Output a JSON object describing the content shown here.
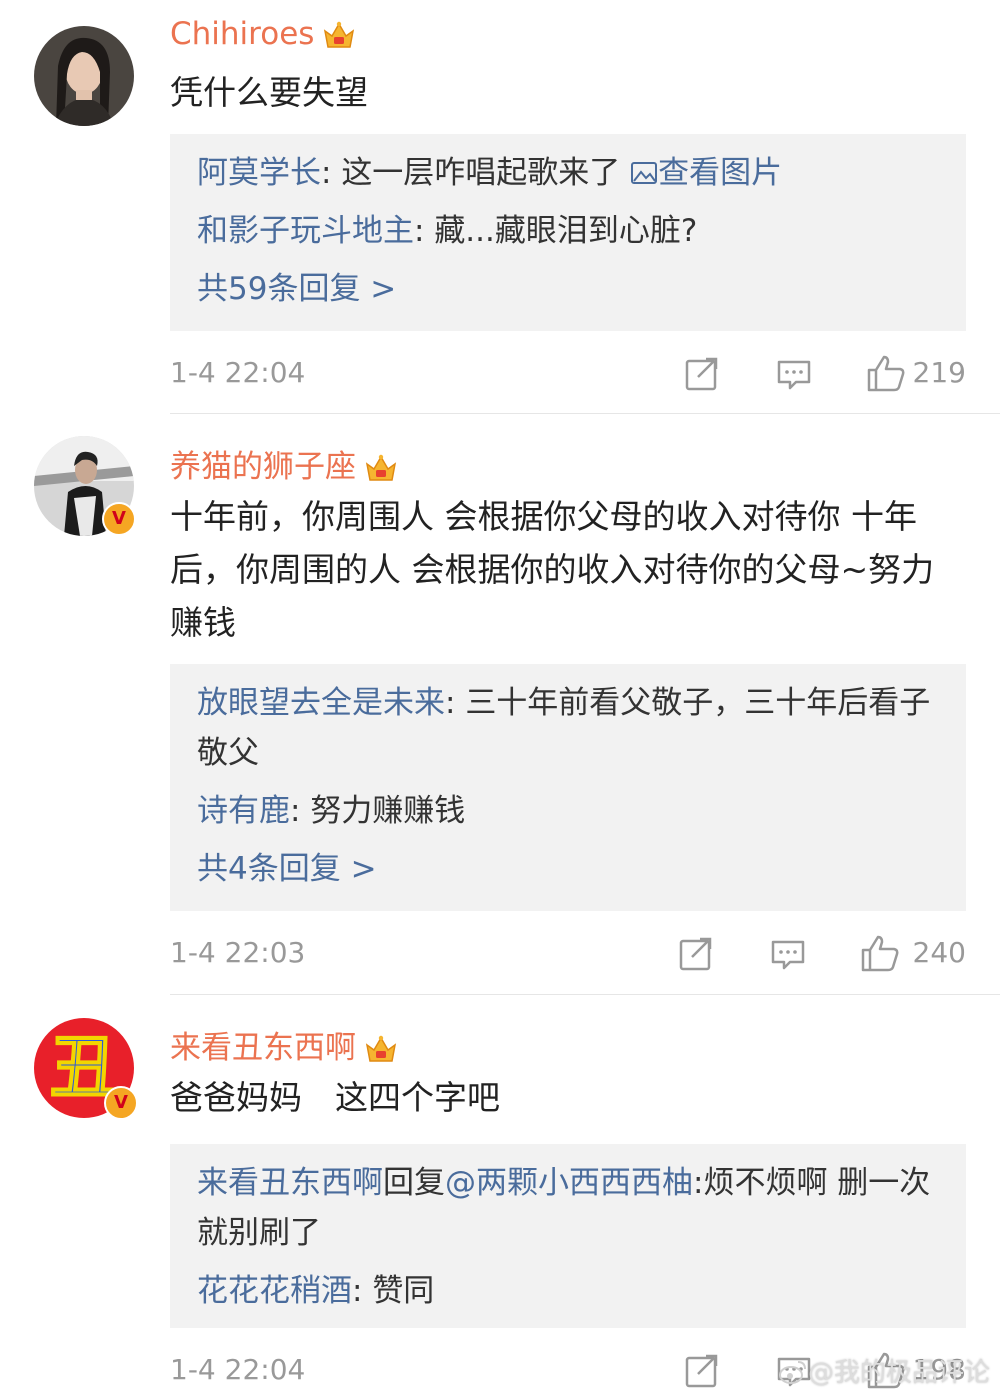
{
  "comments": [
    {
      "username": "Chihiroes",
      "text": "凭什么要失望",
      "replies": [
        {
          "name": "阿莫学长",
          "text": "这一层咋唱起歌来了",
          "link": "查看图片"
        },
        {
          "name": "和影子玩斗地主",
          "text": "藏...藏眼泪到心脏?"
        }
      ],
      "more": "共59条回复 >",
      "time": "1-4 22:04",
      "likes": "219"
    },
    {
      "username": "养猫的狮子座",
      "text": "十年前，你周围人 会根据你父母的收入对待你 十年后，你周围的人 会根据你的收入对待你的父母~努力赚钱",
      "replies": [
        {
          "name": "放眼望去全是未来",
          "text": "三十年前看父敬子，三十年后看子敬父"
        },
        {
          "name": "诗有鹿",
          "text": "努力赚赚钱"
        }
      ],
      "more": "共4条回复 >",
      "time": "1-4 22:03",
      "likes": "240"
    },
    {
      "username": "来看丑东西啊",
      "avatar_char": "丑",
      "text": "爸爸妈妈　这四个字吧",
      "replies": [
        {
          "name": "来看丑东西啊",
          "mid": "回复",
          "mention": "@两颗小西西西柚",
          "text": "烦不烦啊 删一次就别刷了"
        },
        {
          "name": "花花花稍酒",
          "text": "赞同"
        }
      ],
      "time": "1-4 22:04",
      "likes": "198"
    }
  ],
  "watermark": "@我的极品评论",
  "colors": {
    "username": "#eb7350",
    "link": "#4a6c9c",
    "reply_bg": "#f2f2f2",
    "meta": "#999999"
  }
}
